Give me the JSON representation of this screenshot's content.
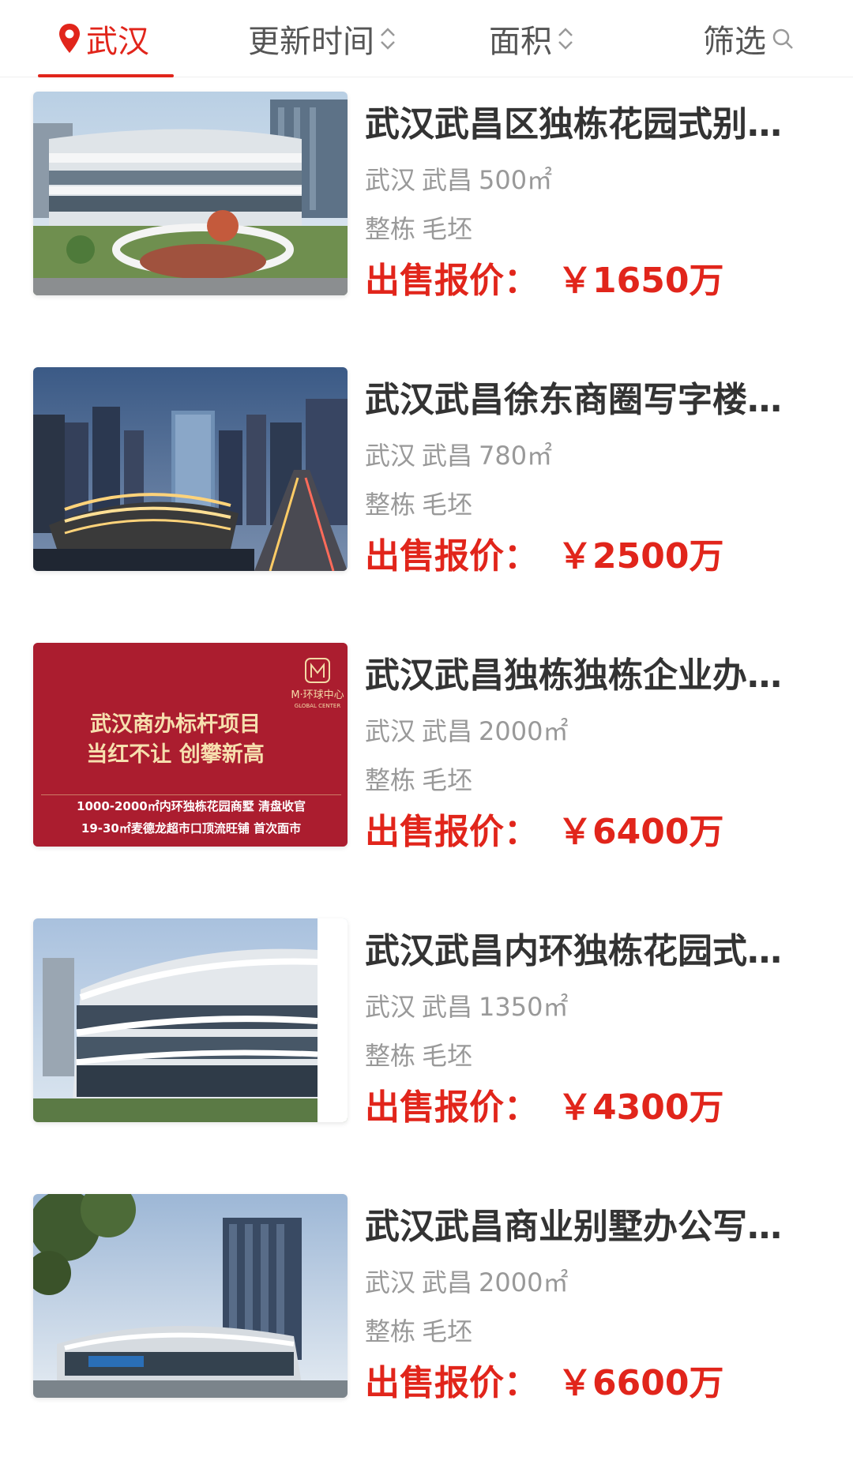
{
  "colors": {
    "accent": "#e1251b",
    "text_primary": "#333333",
    "text_secondary": "#999999"
  },
  "filter_bar": {
    "city": "武汉",
    "sort_update": "更新时间",
    "sort_area": "面积",
    "filter": "筛选"
  },
  "listings": [
    {
      "title": "武汉武昌区独栋花园式别墅办公楼",
      "city": "武汉",
      "district": "武昌",
      "area": "500㎡",
      "type": "整栋",
      "decor": "毛坯",
      "price_label": "出售报价：",
      "price": "￥1650万",
      "image": "building-photo"
    },
    {
      "title": "武汉武昌徐东商圈写字楼整栋出售",
      "city": "武汉",
      "district": "武昌",
      "area": "780㎡",
      "type": "整栋",
      "decor": "毛坯",
      "price_label": "出售报价：",
      "price": "￥2500万",
      "image": "city-night-photo"
    },
    {
      "title": "武汉武昌独栋独栋企业办公楼",
      "city": "武汉",
      "district": "武昌",
      "area": "2000㎡",
      "type": "整栋",
      "decor": "毛坯",
      "price_label": "出售报价：",
      "price": "￥6400万",
      "image": "promo-banner",
      "banner": {
        "brand": "M·环球中心",
        "brand_en": "GLOBAL CENTER",
        "line1": "武汉商办标杆项目",
        "line2": "当红不让 创攀新高",
        "line3": "1000-2000㎡内环独栋花园商墅 清盘收官",
        "line4": "19-30㎡麦德龙超市口顶流旺铺 首次面市"
      }
    },
    {
      "title": "武汉武昌内环独栋花园式别墅",
      "city": "武汉",
      "district": "武昌",
      "area": "1350㎡",
      "type": "整栋",
      "decor": "毛坯",
      "price_label": "出售报价：",
      "price": "￥4300万",
      "image": "building-photo"
    },
    {
      "title": "武汉武昌商业别墅办公写字楼",
      "city": "武汉",
      "district": "武昌",
      "area": "2000㎡",
      "type": "整栋",
      "decor": "毛坯",
      "price_label": "出售报价：",
      "price": "￥6600万",
      "image": "tower-photo"
    }
  ]
}
